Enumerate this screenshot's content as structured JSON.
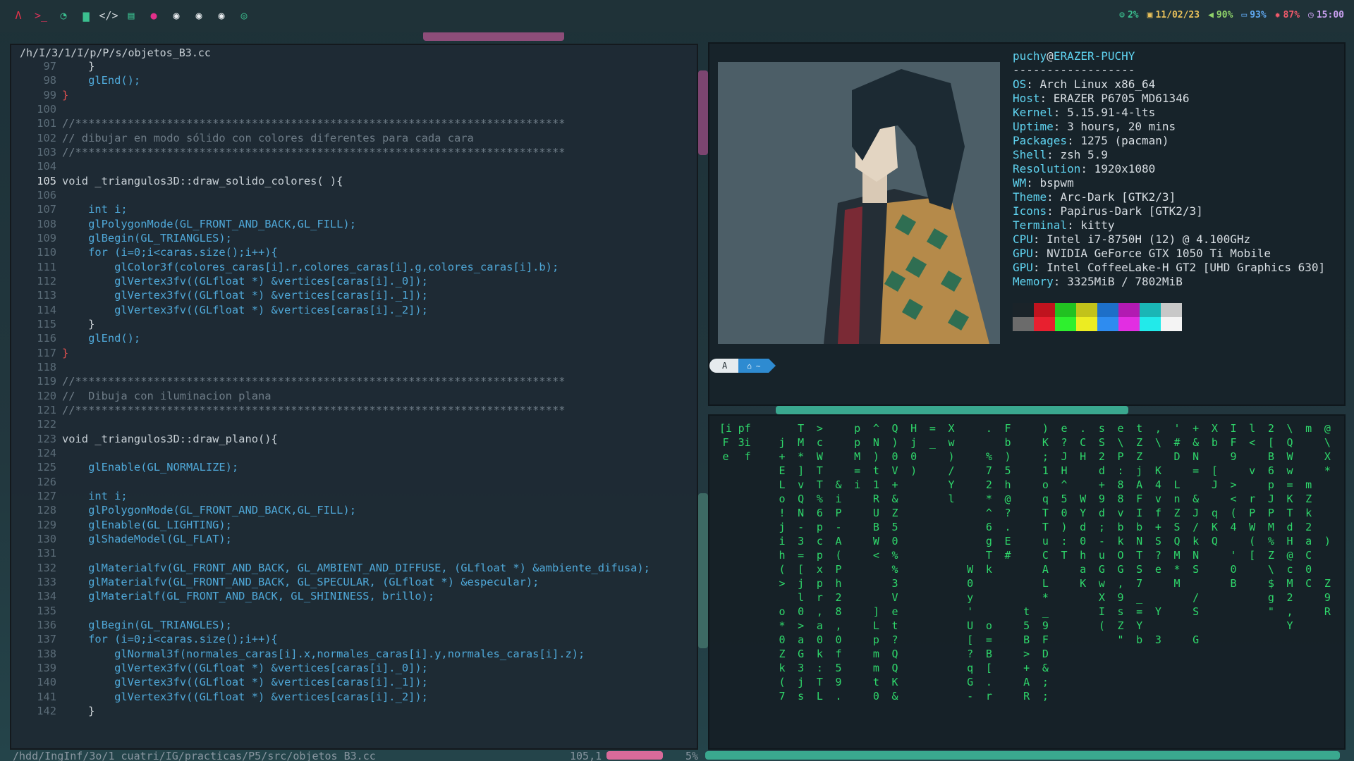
{
  "topbar": {
    "left_icons": [
      "arch-icon",
      "terminal-icon",
      "browser-icon",
      "folder-icon",
      "code-icon",
      "document-icon",
      "app-icon",
      "circle-icon",
      "circle-icon",
      "circle-icon",
      "circle-outline-icon"
    ],
    "status": [
      {
        "icon": "gear-icon",
        "glyph": "⚙",
        "text": "2%",
        "color": "#3bbf8f"
      },
      {
        "icon": "calendar-icon",
        "glyph": "▣",
        "text": "11/02/23",
        "color": "#e8c05a"
      },
      {
        "icon": "volume-icon",
        "glyph": "◀",
        "text": "90%",
        "color": "#8fd36a"
      },
      {
        "icon": "battery-icon",
        "glyph": "▭",
        "text": "93%",
        "color": "#5fa8f0"
      },
      {
        "icon": "memory-icon",
        "glyph": "✹",
        "text": "87%",
        "color": "#f05a6b"
      },
      {
        "icon": "clock-icon",
        "glyph": "◷",
        "text": "15:00",
        "color": "#c9a0f0"
      }
    ]
  },
  "vim": {
    "title": "/h/I/3/1/I/p/P/s/objetos_B3.cc",
    "lines": [
      {
        "n": "97",
        "t": "    }"
      },
      {
        "n": "98",
        "t": "    glEnd();"
      },
      {
        "n": "99",
        "t": "}"
      },
      {
        "n": "100",
        "t": ""
      },
      {
        "n": "101",
        "t": "//***************************************************************************"
      },
      {
        "n": "102",
        "t": "// dibujar en modo sólido con colores diferentes para cada cara"
      },
      {
        "n": "103",
        "t": "//***************************************************************************"
      },
      {
        "n": "104",
        "t": ""
      },
      {
        "n": "105",
        "t": "void _triangulos3D::draw_solido_colores( ){",
        "cur": true
      },
      {
        "n": "106",
        "t": ""
      },
      {
        "n": "107",
        "t": "    int i;"
      },
      {
        "n": "108",
        "t": "    glPolygonMode(GL_FRONT_AND_BACK,GL_FILL);"
      },
      {
        "n": "109",
        "t": "    glBegin(GL_TRIANGLES);"
      },
      {
        "n": "110",
        "t": "    for (i=0;i<caras.size();i++){"
      },
      {
        "n": "111",
        "t": "        glColor3f(colores_caras[i].r,colores_caras[i].g,colores_caras[i].b);"
      },
      {
        "n": "112",
        "t": "        glVertex3fv((GLfloat *) &vertices[caras[i]._0]);"
      },
      {
        "n": "113",
        "t": "        glVertex3fv((GLfloat *) &vertices[caras[i]._1]);"
      },
      {
        "n": "114",
        "t": "        glVertex3fv((GLfloat *) &vertices[caras[i]._2]);"
      },
      {
        "n": "115",
        "t": "    }"
      },
      {
        "n": "116",
        "t": "    glEnd();"
      },
      {
        "n": "117",
        "t": "}"
      },
      {
        "n": "118",
        "t": ""
      },
      {
        "n": "119",
        "t": "//***************************************************************************"
      },
      {
        "n": "120",
        "t": "//  Dibuja con iluminacion plana"
      },
      {
        "n": "121",
        "t": "//***************************************************************************"
      },
      {
        "n": "122",
        "t": ""
      },
      {
        "n": "123",
        "t": "void _triangulos3D::draw_plano(){"
      },
      {
        "n": "124",
        "t": ""
      },
      {
        "n": "125",
        "t": "    glEnable(GL_NORMALIZE);"
      },
      {
        "n": "126",
        "t": ""
      },
      {
        "n": "127",
        "t": "    int i;"
      },
      {
        "n": "128",
        "t": "    glPolygonMode(GL_FRONT_AND_BACK,GL_FILL);"
      },
      {
        "n": "129",
        "t": "    glEnable(GL_LIGHTING);"
      },
      {
        "n": "130",
        "t": "    glShadeModel(GL_FLAT);"
      },
      {
        "n": "131",
        "t": ""
      },
      {
        "n": "132",
        "t": "    glMaterialfv(GL_FRONT_AND_BACK, GL_AMBIENT_AND_DIFFUSE, (GLfloat *) &ambiente_difusa);"
      },
      {
        "n": "133",
        "t": "    glMaterialfv(GL_FRONT_AND_BACK, GL_SPECULAR, (GLfloat *) &especular);"
      },
      {
        "n": "134",
        "t": "    glMaterialf(GL_FRONT_AND_BACK, GL_SHININESS, brillo);"
      },
      {
        "n": "135",
        "t": ""
      },
      {
        "n": "136",
        "t": "    glBegin(GL_TRIANGLES);"
      },
      {
        "n": "137",
        "t": "    for (i=0;i<caras.size();i++){"
      },
      {
        "n": "138",
        "t": "        glNormal3f(normales_caras[i].x,normales_caras[i].y,normales_caras[i].z);"
      },
      {
        "n": "139",
        "t": "        glVertex3fv((GLfloat *) &vertices[caras[i]._0]);"
      },
      {
        "n": "140",
        "t": "        glVertex3fv((GLfloat *) &vertices[caras[i]._1]);"
      },
      {
        "n": "141",
        "t": "        glVertex3fv((GLfloat *) &vertices[caras[i]._2]);"
      },
      {
        "n": "142",
        "t": "    }"
      }
    ],
    "status": {
      "path": "/hdd/IngInf/3o/1_cuatri/IG/practicas/P5/src/objetos_B3.cc",
      "pos": "105,1",
      "pct": "5%"
    }
  },
  "fetch": {
    "user": "puchy",
    "host": "ERAZER-PUCHY",
    "separator": "------------------",
    "rows": [
      {
        "k": "OS",
        "v": "Arch Linux x86_64"
      },
      {
        "k": "Host",
        "v": "ERAZER P6705 MD61346"
      },
      {
        "k": "Kernel",
        "v": "5.15.91-4-lts"
      },
      {
        "k": "Uptime",
        "v": "3 hours, 20 mins"
      },
      {
        "k": "Packages",
        "v": "1275 (pacman)"
      },
      {
        "k": "Shell",
        "v": "zsh 5.9"
      },
      {
        "k": "Resolution",
        "v": "1920x1080"
      },
      {
        "k": "WM",
        "v": "bspwm"
      },
      {
        "k": "Theme",
        "v": "Arc-Dark [GTK2/3]"
      },
      {
        "k": "Icons",
        "v": "Papirus-Dark [GTK2/3]"
      },
      {
        "k": "Terminal",
        "v": "kitty"
      },
      {
        "k": "CPU",
        "v": "Intel i7-8750H (12) @ 4.100GHz"
      },
      {
        "k": "GPU",
        "v": "NVIDIA GeForce GTX 1050 Ti Mobile"
      },
      {
        "k": "GPU",
        "v": "Intel CoffeeLake-H GT2 [UHD Graphics 630]"
      },
      {
        "k": "Memory",
        "v": "3325MiB / 7802MiB"
      }
    ],
    "palette_top": [
      "#1a2329",
      "#c0131e",
      "#21c221",
      "#c2c21a",
      "#1d6fc8",
      "#b21ab2",
      "#1ab6b6",
      "#c8c8c8"
    ],
    "palette_bottom": [
      "#6b6b6b",
      "#e8202f",
      "#2ef02e",
      "#ecec22",
      "#2e8cf0",
      "#e22ee2",
      "#22eaea",
      "#f4f4f4"
    ],
    "prompt": {
      "arch": "A",
      "home": "⌂",
      "tilde": "~"
    }
  },
  "matrix": {
    "columns": [
      "[i\nF\ne",
      "pf\n3i\n f\n\n\n",
      " \n \n \n \n",
      "  \nj\n+\nE\nL\no\n!\nj\ni\nh\n(\n>\n\no\n*\n0\nZ\nk\n(\n7",
      "T\nM\n*\n]\nv\nQ\nN\n-\n3\n=\n[\nj\nl\n0\n>\na\nG\n3\nj\ns",
      ">\nc\nW\nT\nT\n%\n6\np\nc\np\nx\np\nr\n,\na\n0\nk\n:\nT\nL",
      " \n \n \n \n&\ni\nP\n-\nA\n(\nP\nh\n2\n8\n,\n0\nf\n5\n9\n.",
      "p\np\nM\n=\ni",
      "^\nN\n)\nt\n1\nR\nU\nB\nW\n<\n\n\n\n]\nL\np\nm\nm\nt\n0",
      "Q\n)\n0\nV\n+\n&\nZ\n5\n0\n%\n%\n3\nV\ne\nt\n?\nQ\nQ\nK\n&",
      "H\nj\n0\n)",
      "=\n_\n",
      "X\nw\n)\n/\nY\nl",
      " \n \n \n \n \n \n \n \n \n \nW\n0\ny\n'\nU\n[\n?\nq\nG\n-",
      ".\n \n%\n7\n2\n*\n^\n6\ng\nT\nk\n\n\n\no\n=\nB\n[\n.\nr",
      "F\nb\n)\n5\nh\n@\n?\n.\nE\n#",
      " \n \n \n \n \n \n \n \n \n \n \n \n \nt\n5\nB\n>\n+\nA\nR",
      ")\nK\n;\n1\no\nq\nT\nT\nu\nC\nA\nL\n*\n_\n9\nF\nD\n&\n;\n;",
      "e\n?\nJ\nH\n^\n5\n0\n)\n:\nT",
      ".\nC\nH\n \n \nW\nY\nd\n0\nh\na\nK",
      "s\nS\n2\nd\n+\n9\nd\n;\n-\nu\nG\nw\nX\nI\n(",
      "e\n\\\nP\n:\n8\n8\nv\nb\nk\nO\nG\n,\n9\ns\nZ\n\"",
      "t\nZ\nZ\nj\nA\nF\nI\nb\nN\nT\nS\n7\n_\n=\nY\nb",
      ",\n\\\n \nK\n4\nv\nf\n+\nS\n?\ne\n \n \nY\n \n3",
      "'\n#\nD\n \nL\nn\nZ\nS\nQ\nM\n*\nM",
      "+\n&\nN\n=\n \n&\nJ\n/\nk\nN\nS\n \n/\nS\n \nG",
      "X\nb\n \n[\nJ\n \nq\nK\nQ",
      "I\nF\n9\n \n>\n<\n(\n4\n \n'\n0\nB",
      "l\n<\n \nv\n \nr\nP\nW\n(\n[",
      "2\n[\nB\n6\np\nJ\nP\nM\n%\nZ\n\\\n$\ng\n\"",
      "\\\nQ\nW\nw\n=\nK\nT\nd\nH\n@\nc\nM\n2\n,\nY",
      "m\n \n \n \nm\nZ\nk\n2\na\nC\n0\nC",
      "@\n\\\nX\n*\n \n \n \n \n)\n \n \nZ\n9\nR"
    ]
  }
}
